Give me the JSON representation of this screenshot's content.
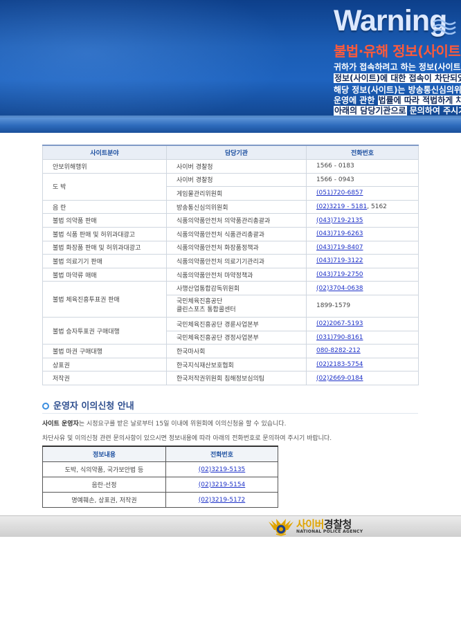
{
  "banner": {
    "title": "Warning",
    "subtitle": "불법·유해 정보(사이트",
    "line1": "귀하가 접속하려고 하는 정보(사이트)에",
    "line2_highlight": "정보(사이트)에 대한 접속이 차단되었",
    "line3": "해당 정보(사이트)는 방송통신심의위원",
    "line4_pre": "운영에 관한 ",
    "line4_highlight": "법률에 따라 적법하게 차단",
    "line5_highlight": "아래의 담당기관으로",
    "line5_post": " 문의하여 주시기"
  },
  "main_table": {
    "headers": [
      "사이트분야",
      "담당기관",
      "전화번호"
    ],
    "rows": [
      {
        "field": "안보위해행위",
        "agencies": [
          {
            "name": "사이버 경찰청",
            "phone": "1566 - 0183"
          }
        ]
      },
      {
        "field": "도 박",
        "agencies": [
          {
            "name": "사이버 경찰청",
            "phone": "1566 - 0943"
          },
          {
            "name": "게임물관리위원회",
            "phone": "(051)720-6857",
            "link": true
          }
        ]
      },
      {
        "field": "음 란",
        "agencies": [
          {
            "name": "방송통신심의위원회",
            "phone": "(02)3219 - 5181",
            "phone_suffix": ", 5162",
            "link": true
          }
        ]
      },
      {
        "field": "불법 의약품 판매",
        "agencies": [
          {
            "name": "식품의약품안전처 의약품관리총괄과",
            "phone": "(043)719-2135",
            "link": true
          }
        ]
      },
      {
        "field": "불법 식품 판매 및 허위과대광고",
        "agencies": [
          {
            "name": "식품의약품안전처 식품관리총괄과",
            "phone": "(043)719-6263",
            "link": true
          }
        ]
      },
      {
        "field": "불법 화장품 판매 및 허위과대광고",
        "agencies": [
          {
            "name": "식품의약품안전처 화장품정책과",
            "phone": "(043)719-8407",
            "link": true
          }
        ]
      },
      {
        "field": "불법 의료기기 판매",
        "agencies": [
          {
            "name": "식품의약품안전처 의료기기관리과",
            "phone": "(043)719-3122",
            "link": true
          }
        ]
      },
      {
        "field": "불법 마약류 매매",
        "agencies": [
          {
            "name": "식품의약품안전처 마약정책과",
            "phone": "(043)719-2750",
            "link": true
          }
        ]
      },
      {
        "field": "불법 체육진흥투표권 판매",
        "agencies": [
          {
            "name": "사행산업통합감독위원회",
            "phone": "(02)3704-0638",
            "link": true
          },
          {
            "name": "국민체육진흥공단",
            "name2": "클린스포츠 통합콜센터",
            "phone": "1899-1579"
          }
        ]
      },
      {
        "field": "불법 승자투표권 구매대행",
        "agencies": [
          {
            "name": "국민체육진흥공단 경륜사업본부",
            "phone": "(02)2067-5193",
            "link": true
          },
          {
            "name": "국민체육진흥공단 경정사업본부",
            "phone": "(031)790-8161",
            "link": true
          }
        ]
      },
      {
        "field": "불법 마권 구매대행",
        "agencies": [
          {
            "name": "한국마사회",
            "phone": "080-8282-212",
            "link": true
          }
        ]
      },
      {
        "field": "상표권",
        "agencies": [
          {
            "name": "한국지식재산보호협회",
            "phone": "(02)2183-5754",
            "link": true
          }
        ]
      },
      {
        "field": "저작권",
        "agencies": [
          {
            "name": "한국저작권위원회 침해정보심의팀",
            "phone": "(02)2669-0184",
            "link": true
          }
        ]
      }
    ]
  },
  "objection": {
    "title": "운영자 이의신청 안내",
    "line1_bold": "사이트 운영자",
    "line1_rest": "는 시정요구를 받은 날로부터 15일 이내에 위원회에 이의신청을 할 수 있습니다.",
    "line2": "차단사유 및 이의신청 관련 문의사항이 있으시면 정보내용에 따라 아래의 전화번호로 문의하여 주시기 바랍니다.",
    "table_headers": [
      "정보내용",
      "전화번호"
    ],
    "rows": [
      {
        "content": "도박, 식의약품, 국가보안법 등",
        "phone": "(02)3219-5135"
      },
      {
        "content": "음란·선정",
        "phone": "(02)3219-5154"
      },
      {
        "content": "명예훼손, 상표권, 저작권",
        "phone": "(02)3219-5172"
      }
    ]
  },
  "footer": {
    "logo_name_part1": "사이버",
    "logo_name_part2": "경찰청",
    "logo_sub": "NATIONAL POLICE AGENCY",
    "logo_icon": "police-emblem-icon"
  },
  "colors": {
    "banner_blue": "#1b5cb3",
    "warning_red": "#ff5a3a",
    "header_text": "#1c4fa0",
    "link": "#1e32c8"
  }
}
